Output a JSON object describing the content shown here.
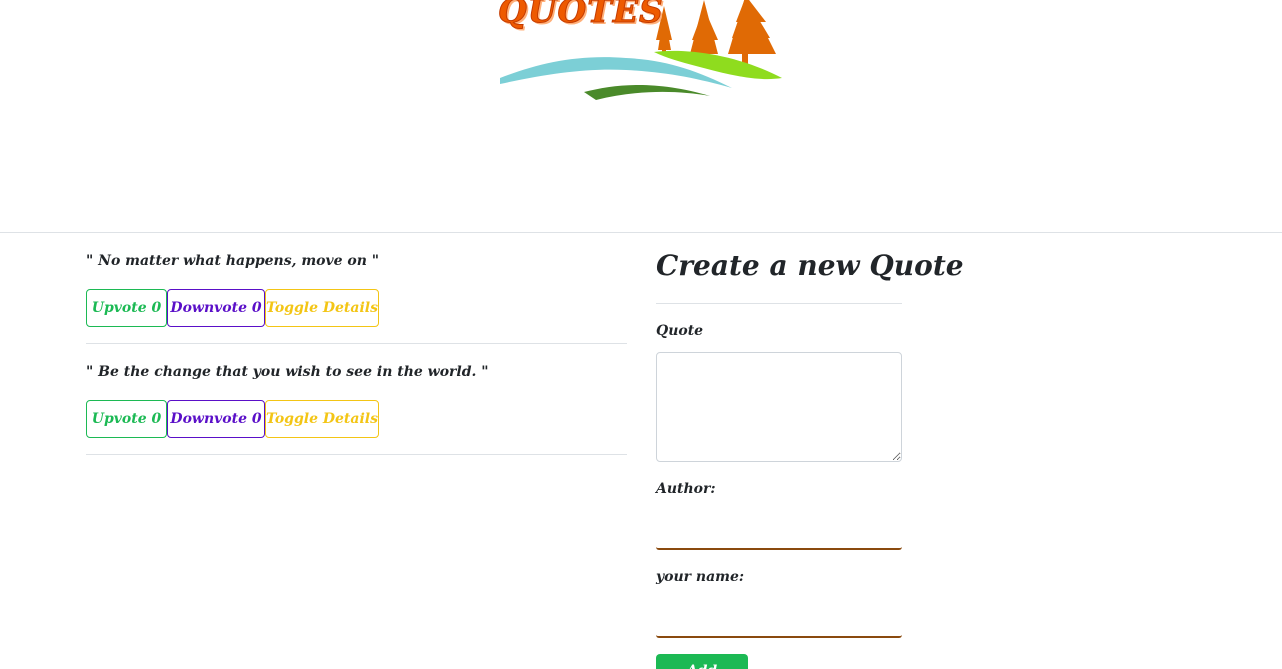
{
  "header": {
    "logo_text": "QUOTES"
  },
  "quotes": [
    {
      "text": "\" No matter what happens, move on \"",
      "upvote_label": "Upvote 0",
      "downvote_label": "Downvote 0",
      "toggle_label": "Toggle Details"
    },
    {
      "text": "\" Be the change that you wish to see in the world. \"",
      "upvote_label": "Upvote 0",
      "downvote_label": "Downvote 0",
      "toggle_label": "Toggle Details"
    }
  ],
  "form": {
    "title": "Create a new Quote",
    "quote_label": "Quote",
    "quote_value": "",
    "author_label": "Author:",
    "author_value": "",
    "name_label": "your name:",
    "name_value": "",
    "submit_label": "Add Quote"
  },
  "colors": {
    "upvote": "#1cb954",
    "downvote": "#5a0fc8",
    "toggle": "#f3c515",
    "logo": "#ee5a00",
    "input_underline": "#8a4a0e"
  }
}
